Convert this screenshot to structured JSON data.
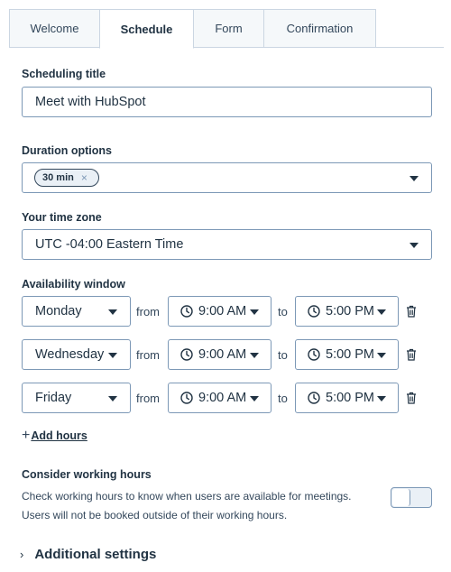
{
  "tabs": [
    {
      "label": "Welcome"
    },
    {
      "label": "Schedule"
    },
    {
      "label": "Form"
    },
    {
      "label": "Confirmation"
    }
  ],
  "active_tab": "Schedule",
  "scheduling_title": {
    "label": "Scheduling title",
    "value": "Meet with HubSpot"
  },
  "duration": {
    "label": "Duration options",
    "chip": "30 min",
    "chip_remove": "×"
  },
  "timezone": {
    "label": "Your time zone",
    "value": "UTC -04:00 Eastern Time"
  },
  "availability": {
    "label": "Availability window",
    "from_label": "from",
    "to_label": "to",
    "rows": [
      {
        "day": "Monday",
        "start": "9:00 AM",
        "end": "5:00 PM"
      },
      {
        "day": "Wednesday",
        "start": "9:00 AM",
        "end": "5:00 PM"
      },
      {
        "day": "Friday",
        "start": "9:00 AM",
        "end": "5:00 PM"
      }
    ],
    "add_hours_prefix": "+",
    "add_hours": "Add hours"
  },
  "working_hours": {
    "label": "Consider working hours",
    "line1": "Check working hours to know when users are available for meetings.",
    "line2": "Users will not be booked outside of their working hours.",
    "toggle_on": false
  },
  "additional_settings": {
    "label": "Additional settings",
    "chevron": "›"
  },
  "icons": {
    "clock": "clock-icon",
    "trash": "trash-icon",
    "caret": "caret-down-icon"
  }
}
